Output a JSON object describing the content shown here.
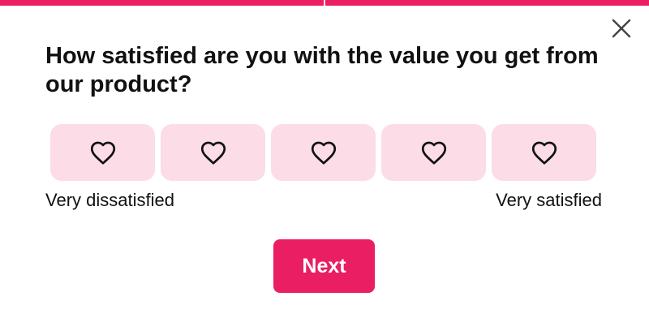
{
  "survey": {
    "question": "How satisfied are you with the value you get from our product?",
    "progress_segments": 2,
    "close_icon": "close-icon",
    "options": [
      {
        "icon": "heart-outline-icon",
        "value": 1
      },
      {
        "icon": "heart-outline-icon",
        "value": 2
      },
      {
        "icon": "heart-outline-icon",
        "value": 3
      },
      {
        "icon": "heart-outline-icon",
        "value": 4
      },
      {
        "icon": "heart-outline-icon",
        "value": 5
      }
    ],
    "scale_min_label": "Very dissatisfied",
    "scale_max_label": "Very satisfied",
    "next_label": "Next"
  },
  "colors": {
    "accent": "#e91e63",
    "option_background": "#fcdce6",
    "text": "#111111",
    "background": "#ffffff"
  }
}
